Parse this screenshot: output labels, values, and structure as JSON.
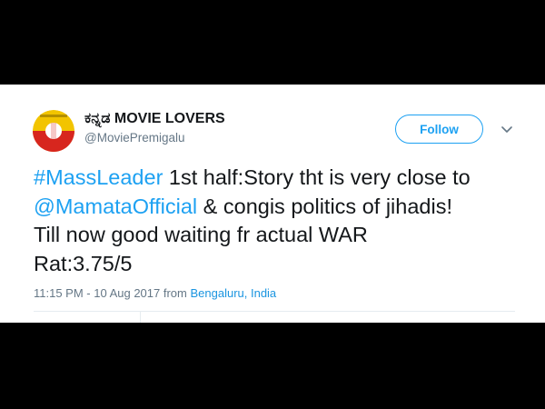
{
  "colors": {
    "background": "#000000",
    "card": "#ffffff",
    "text": "#14171a",
    "secondary_text": "#657786",
    "link": "#1da1f2",
    "avatar_yellow": "#f2c400",
    "avatar_red": "#d7261e"
  },
  "author": {
    "name": "ಕನ್ನಡ MOVIE LOVERS",
    "handle": "@MoviePremigalu",
    "avatar_icon": "kannada-flag-logo-icon"
  },
  "follow_button": {
    "label": "Follow"
  },
  "more_icon": "chevron-down-icon",
  "tweet": {
    "hashtag": "#MassLeader",
    "line1_rest": " 1st half:Story tht is very close to",
    "mention": "@MamataOfficial",
    "line2_rest": " & congis politics of jihadis!",
    "line3": "Till now good waiting fr actual WAR",
    "line4": "Rat:3.75/5"
  },
  "meta": {
    "timestamp": "11:15 PM - 10 Aug 2017",
    "from_prefix": " from ",
    "location": "Bengaluru, India"
  }
}
